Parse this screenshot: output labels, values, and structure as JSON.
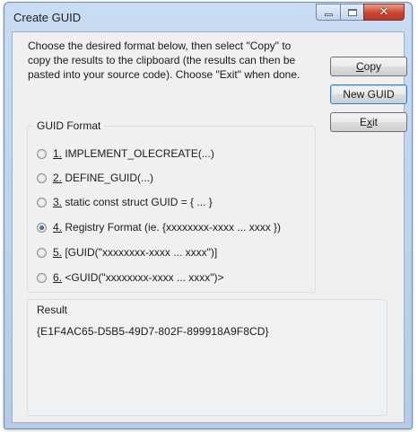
{
  "window": {
    "title": "Create GUID"
  },
  "instructions": "Choose the desired format below, then select \"Copy\" to copy the results to the clipboard (the results can then be pasted into your source code).  Choose \"Exit\" when done.",
  "buttons": {
    "copy": {
      "mnemonic": "C",
      "rest": "opy"
    },
    "new_guid": {
      "label": "New GUID"
    },
    "exit": {
      "first": "E",
      "mnemonic": "x",
      "rest": "it"
    }
  },
  "guid_format": {
    "label": "GUID Format",
    "selected_index": 3,
    "options": [
      {
        "number": "1.",
        "text": " IMPLEMENT_OLECREATE(...)"
      },
      {
        "number": "2.",
        "text": " DEFINE_GUID(...)"
      },
      {
        "number": "3.",
        "text": " static const struct GUID = { ... }"
      },
      {
        "number": "4.",
        "text": " Registry Format (ie. {xxxxxxxx-xxxx ... xxxx })"
      },
      {
        "number": "5.",
        "text": " [GUID(\"xxxxxxxx-xxxx ... xxxx\")]"
      },
      {
        "number": "6.",
        "text": " <GUID(\"xxxxxxxx-xxxx ... xxxx\")>"
      }
    ]
  },
  "result": {
    "label": "Result",
    "value": "{E1F4AC65-D5B5-49D7-802F-899918A9F8CD}"
  },
  "icons": {
    "minimize": "minimize-icon",
    "maximize": "maximize-icon",
    "close": "close-icon"
  },
  "colors": {
    "title_bar": "#c9dcf2",
    "dialog_background": "#f0f0f0",
    "close_button": "#c9462f",
    "default_button_border": "#3c7fb1"
  }
}
